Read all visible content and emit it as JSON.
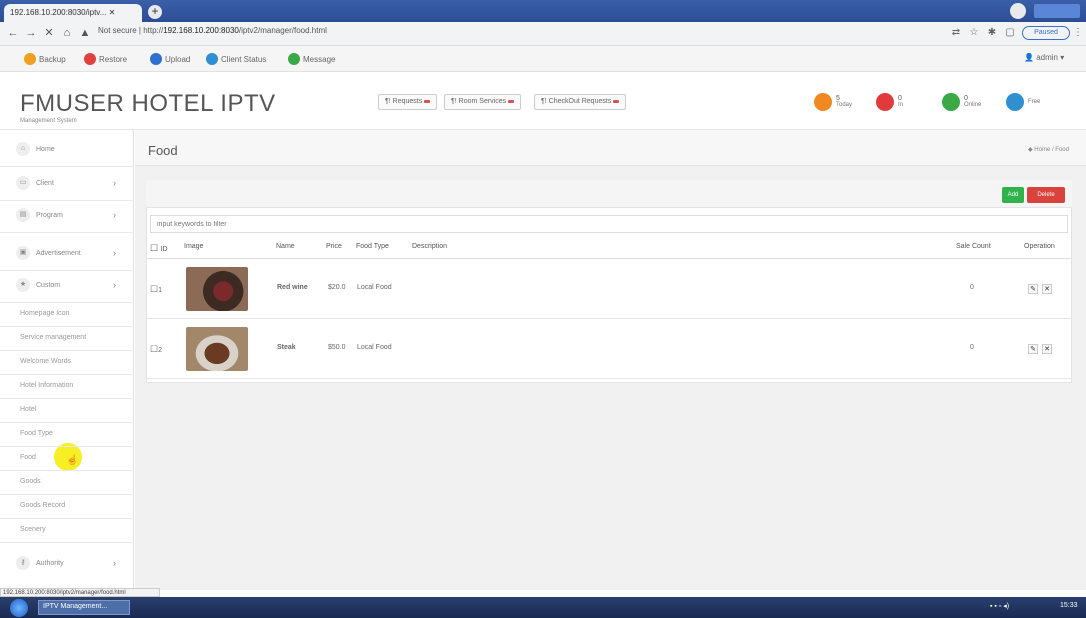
{
  "browser": {
    "tab_title": "192.168.10.200:8030/iptv...",
    "url_prefix": "Not secure | http://",
    "url_host": "192.168.10.200:8030",
    "url_path": "/iptv2/manager/food.html",
    "paused_label": "Paused"
  },
  "toolbar": {
    "items": [
      {
        "label": "Backup",
        "color": "#f0a020"
      },
      {
        "label": "Restore",
        "color": "#e04040"
      },
      {
        "label": "Upload",
        "color": "#2f6fd0"
      },
      {
        "label": "Client Status",
        "color": "#2f8fd0"
      },
      {
        "label": "Message",
        "color": "#3aa845"
      }
    ],
    "admin": "admin"
  },
  "header": {
    "brand": "FMUSER HOTEL IPTV",
    "subtitle": "Management System",
    "buttons": [
      "Requests",
      "Room Services",
      "CheckOut Requests"
    ],
    "stats": [
      {
        "value": "5",
        "label": "Today",
        "color": "#f08a20"
      },
      {
        "value": "0",
        "label": "In",
        "color": "#e03a3a"
      },
      {
        "value": "0",
        "label": "Online",
        "color": "#3aa845"
      },
      {
        "value": "",
        "label": "Free",
        "color": "#2f8fd0"
      }
    ]
  },
  "sidebar": {
    "nav": [
      {
        "label": "Home",
        "icon": "home-icon",
        "has_chevron": false
      },
      {
        "label": "Client",
        "icon": "monitor-icon",
        "has_chevron": true
      },
      {
        "label": "Program",
        "icon": "film-icon",
        "has_chevron": true
      },
      {
        "label": "Advertisement",
        "icon": "image-icon",
        "has_chevron": true
      },
      {
        "label": "Custom",
        "icon": "star-icon",
        "has_chevron": true
      }
    ],
    "submenu": [
      "Homepage Icon",
      "Service management",
      "Welcome Words",
      "Hotel Information",
      "Hotel",
      "Food Type",
      "Food",
      "Goods",
      "Goods Record",
      "Scenery"
    ],
    "authority": "Authority"
  },
  "page": {
    "title": "Food",
    "breadcrumb": "Home / Food",
    "add_label": "Add",
    "delete_label": "Delete",
    "filter_placeholder": "input keywords to filter",
    "columns": [
      "ID",
      "Image",
      "Name",
      "Price",
      "Food Type",
      "Description",
      "Sale Count",
      "Operation"
    ],
    "rows": [
      {
        "id": "1",
        "image": "red-wine-photo",
        "name": "Red wine",
        "price": "$20.0",
        "type": "Local Food",
        "description": "",
        "sale_count": "0"
      },
      {
        "id": "2",
        "image": "steak-photo",
        "name": "Steak",
        "price": "$50.0",
        "type": "Local Food",
        "description": "",
        "sale_count": "0"
      }
    ]
  },
  "status_url": "192.168.10.200:8030/iptv2/manager/food.html",
  "taskbar": {
    "app": "IPTV Management...",
    "clock": "15:33"
  }
}
